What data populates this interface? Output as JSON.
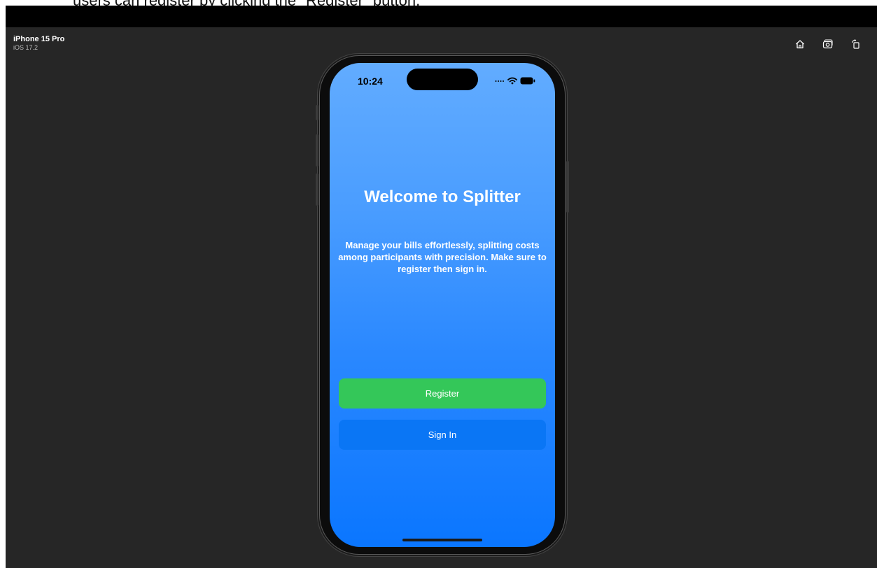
{
  "document": {
    "caption": "users can register by clicking the \"Register\" button."
  },
  "simulator": {
    "device_name": "iPhone 15 Pro",
    "os_version": "iOS 17.2",
    "toolbar": [
      {
        "icon": "home-icon"
      },
      {
        "icon": "screenshot-icon"
      },
      {
        "icon": "rotate-icon"
      }
    ]
  },
  "status_bar": {
    "time": "10:24",
    "icons": [
      "signal-dots-icon",
      "wifi-icon",
      "battery-icon"
    ]
  },
  "app": {
    "title": "Welcome to Splitter",
    "subtitle": "Manage your bills effortlessly, splitting costs among participants with precision. Make sure to register then sign in.",
    "register_label": "Register",
    "signin_label": "Sign In"
  },
  "colors": {
    "gradient_top": "#62acff",
    "gradient_bottom": "#0a76ff",
    "register_button": "#34c759",
    "signin_button": "#0a76f5",
    "simulator_background": "#262626"
  }
}
